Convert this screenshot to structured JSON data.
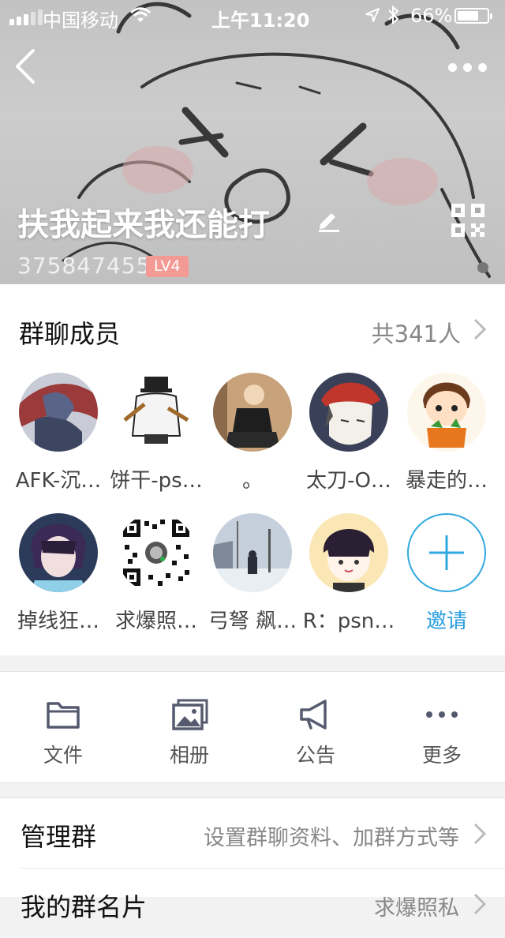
{
  "status_bar": {
    "carrier": "中国移动",
    "time": "上午11:20",
    "battery": "66%"
  },
  "group": {
    "name": "扶我起来我还能打",
    "id": "375847455",
    "level": "LV4"
  },
  "members": {
    "title": "群聊成员",
    "count": "共341人",
    "list": [
      {
        "name": "AFK-沉…"
      },
      {
        "name": "饼干-ps…"
      },
      {
        "name": "。"
      },
      {
        "name": "太刀-O…"
      },
      {
        "name": "暴走的…"
      },
      {
        "name": "掉线狂…"
      },
      {
        "name": "求爆照…"
      },
      {
        "name": "弓弩 飙…"
      },
      {
        "name": "R：psn…"
      }
    ],
    "invite_label": "邀请"
  },
  "actions": [
    {
      "label": "文件",
      "icon": "folder-icon"
    },
    {
      "label": "相册",
      "icon": "album-icon"
    },
    {
      "label": "公告",
      "icon": "megaphone-icon"
    },
    {
      "label": "更多",
      "icon": "more-icon"
    }
  ],
  "settings": {
    "manage": {
      "label": "管理群",
      "value": "设置群聊资料、加群方式等"
    },
    "card": {
      "label": "我的群名片",
      "value": "求爆照私"
    }
  },
  "colors": {
    "accent": "#2b9fe0",
    "level_badge": "#f29a93"
  }
}
